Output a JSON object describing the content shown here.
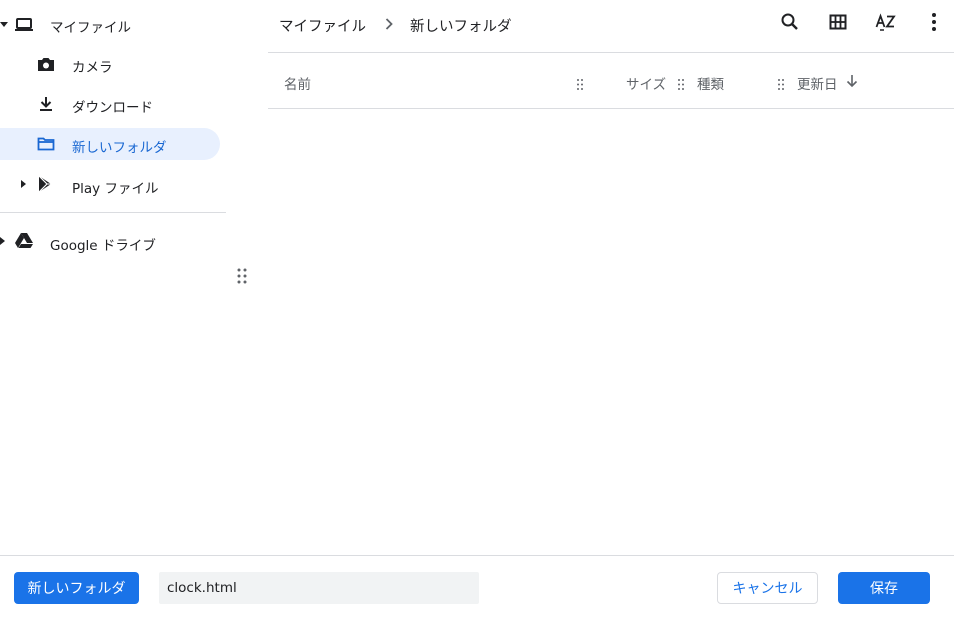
{
  "sidebar": {
    "my_files": "マイファイル",
    "camera": "カメラ",
    "downloads": "ダウンロード",
    "new_folder": "新しいフォルダ",
    "play_files": "Play ファイル",
    "google_drive": "Google ドライブ"
  },
  "breadcrumb": {
    "root": "マイファイル",
    "current": "新しいフォルダ"
  },
  "toolbar": {
    "icons": [
      "search-icon",
      "grid-view-icon",
      "sort-az-icon",
      "more-vert-icon"
    ]
  },
  "columns": {
    "name": "名前",
    "size": "サイズ",
    "type": "種類",
    "modified": "更新日"
  },
  "footer": {
    "new_folder_button": "新しいフォルダ",
    "filename_value": "clock.html",
    "cancel_button": "キャンセル",
    "save_button": "保存"
  },
  "colors": {
    "accent": "#1a73e8",
    "selected_bg": "#e8f0fe",
    "divider": "#dadce0"
  }
}
